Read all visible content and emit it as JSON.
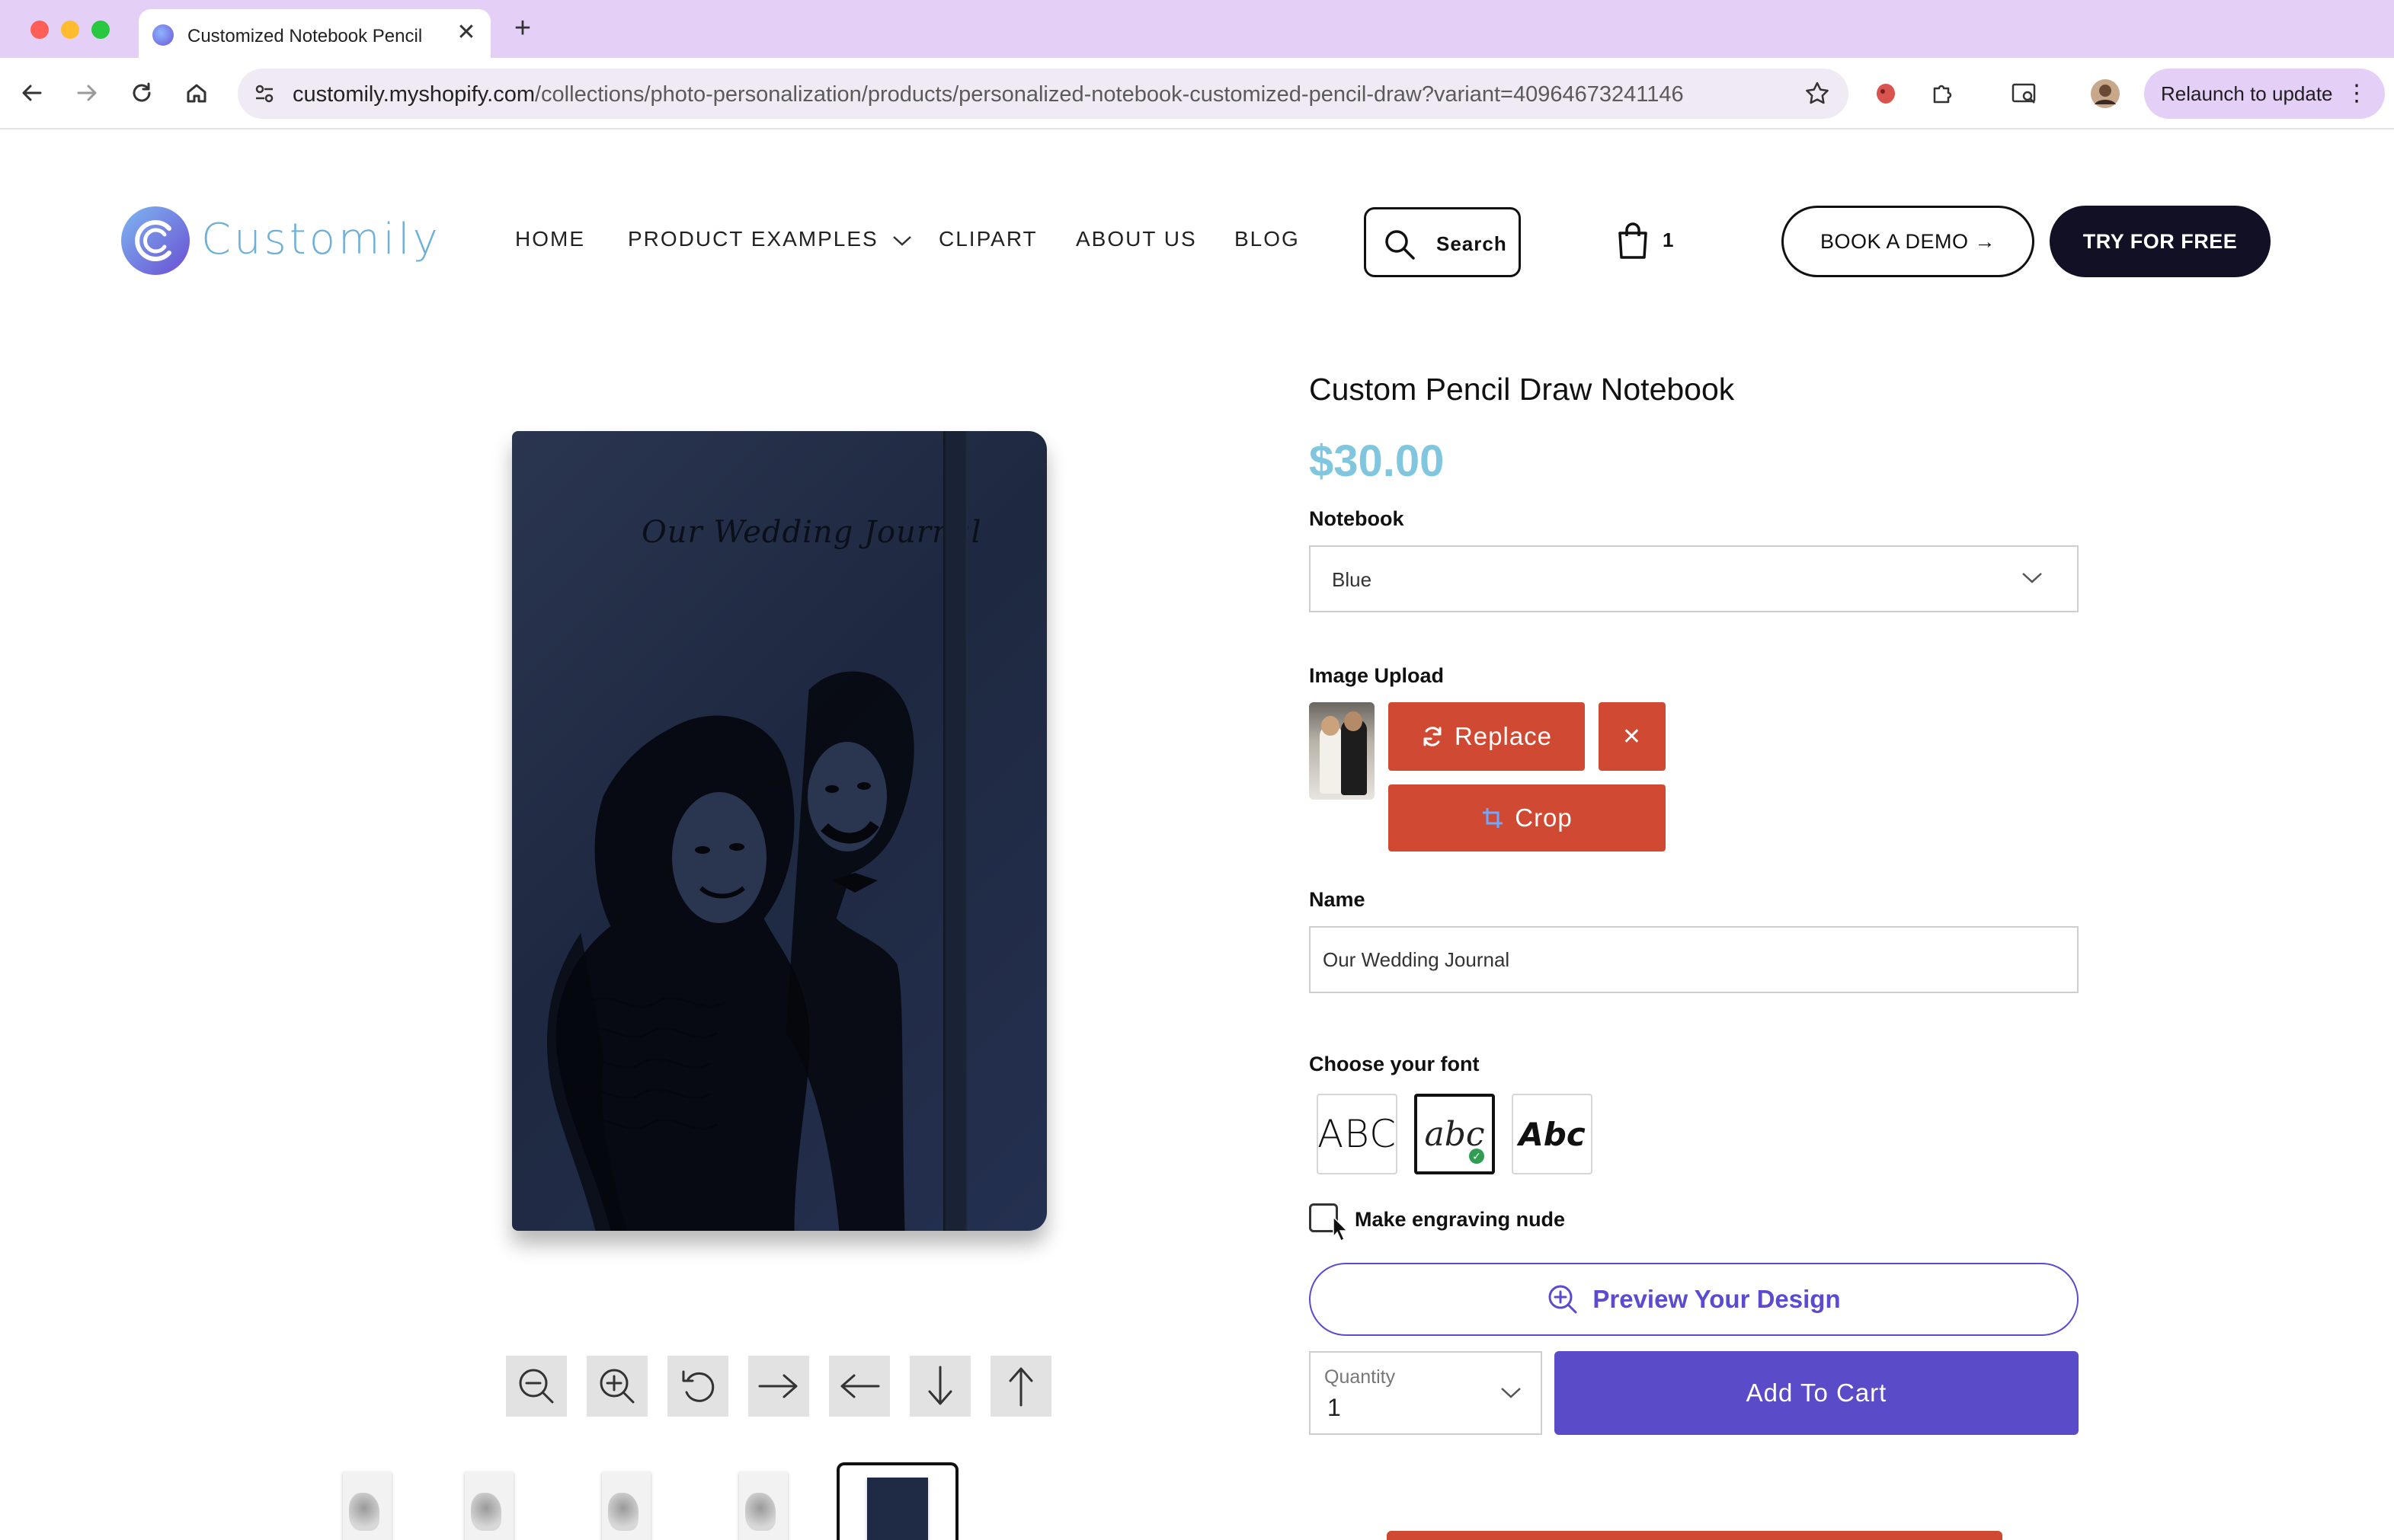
{
  "browser": {
    "tab_title": "Customized Notebook Pencil",
    "tab_close": "✕",
    "new_tab": "+",
    "url_host": "customily.myshopify.com",
    "url_path": "/collections/photo-personalization/products/personalized-notebook-customized-pencil-draw?variant=40964673241146",
    "relaunch_label": "Relaunch to update",
    "relaunch_menu": "⋮",
    "traffic_colors": [
      "#ff5f57",
      "#febc2e",
      "#28c840"
    ]
  },
  "header": {
    "logo_text": "Customily",
    "nav": [
      {
        "label": "HOME"
      },
      {
        "label": "PRODUCT EXAMPLES"
      },
      {
        "label": "CLIPART"
      },
      {
        "label": "ABOUT US"
      },
      {
        "label": "BLOG"
      }
    ],
    "search_label": "Search",
    "cart_count": "1",
    "demo_label": "BOOK A DEMO →",
    "free_label": "TRY FOR FREE"
  },
  "product": {
    "notebook_title": "Our Wedding Journal",
    "title": "Custom Pencil Draw Notebook",
    "price": "$30.00",
    "notebook_label": "Notebook",
    "notebook_value": "Blue",
    "upload_label": "Image Upload",
    "replace_label": "Replace",
    "remove_label": "✕",
    "crop_label": "Crop",
    "name_label": "Name",
    "name_value": "Our Wedding Journal",
    "font_label": "Choose your font",
    "fonts": [
      {
        "sample": "ABC"
      },
      {
        "sample": "abc"
      },
      {
        "sample": "Abc"
      }
    ],
    "font_selected_mark": "✓",
    "nude_label": "Make engraving nude",
    "preview_label": "Preview Your Design",
    "quantity_label": "Quantity",
    "quantity_value": "1",
    "add_to_cart_label": "Add To Cart"
  },
  "colors": {
    "brand_purple": "#5a4bc8",
    "price_blue": "#7fc6de",
    "action_red": "#d04a33",
    "dark_button": "#111024"
  }
}
